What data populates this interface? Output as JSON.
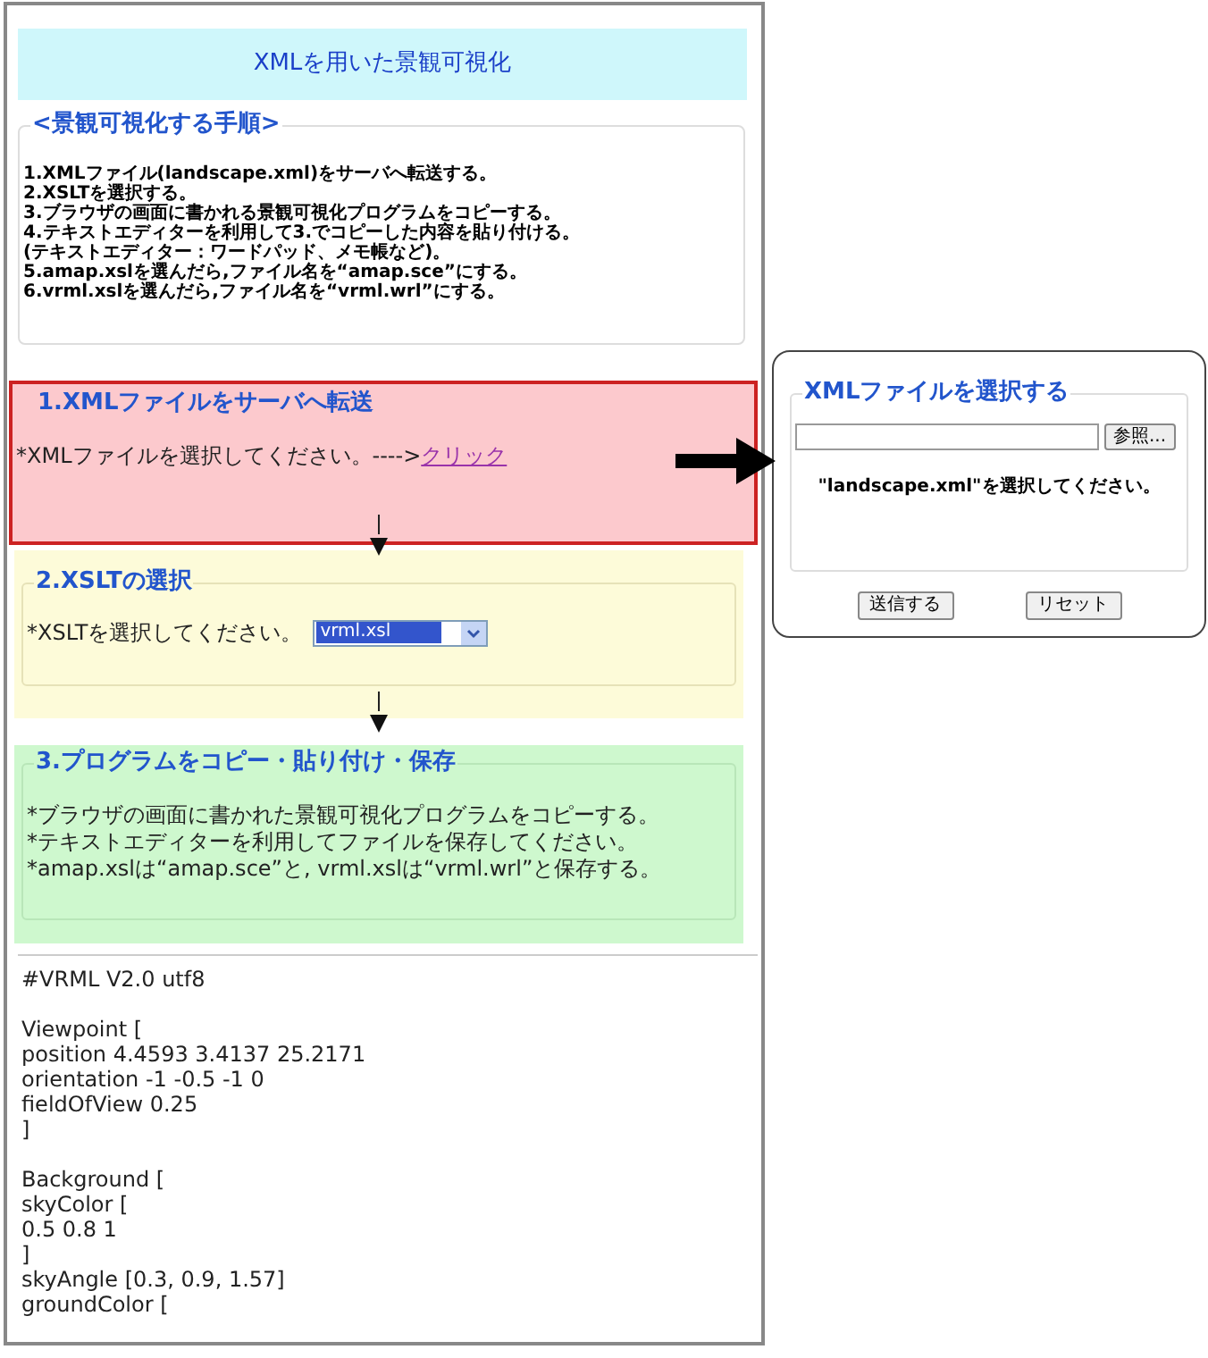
{
  "page_title": "XMLを用いた景観可視化",
  "procedure": {
    "legend": "<景観可視化する手順>",
    "steps": [
      "1.XMLファイル(landscape.xml)をサーバへ転送する。",
      "2.XSLTを選択する。",
      "3.ブラウザの画面に書かれる景観可視化プログラムをコピーする。",
      "4.テキストエディターを利用して3.でコピーした内容を貼り付ける。",
      "(テキストエディター：ワードパッド、メモ帳など)。",
      "5.amap.xslを選んだら,ファイル名を“amap.sce”にする。",
      "6.vrml.xslを選んだら,ファイル名を“vrml.wrl”にする。"
    ]
  },
  "sections": [
    {
      "kind": "upload",
      "highlighted": true,
      "title": "1.XMLファイルをサーバへ転送",
      "prompt": "*XMLファイルを選択してください。---->",
      "link": {
        "label": "クリック",
        "visited": true
      }
    },
    {
      "kind": "select",
      "highlighted": false,
      "title": "2.XSLTの選択",
      "prompt": "*XSLTを選択してください。",
      "select": {
        "value": "vrml.xsl",
        "focused": true
      }
    },
    {
      "kind": "notes",
      "highlighted": false,
      "title": "3.プログラムをコピー・貼り付け・保存",
      "lines": [
        "*ブラウザの画面に書かれた景観可視化プログラムをコピーする。",
        "*テキストエディターを利用してファイルを保存してください。",
        "*amap.xslは“amap.sce”と, vrml.xslは“vrml.wrl”と保存する。"
      ]
    }
  ],
  "vrml_output": [
    [
      "#VRML V2.0 utf8"
    ],
    [
      "Viewpoint [",
      "position 4.4593 3.4137 25.2171",
      "orientation -1 -0.5 -1 0",
      "fieldOfView 0.25",
      "]"
    ],
    [
      "Background [",
      "skyColor [",
      "0.5 0.8 1",
      "]",
      "skyAngle [0.3, 0.9, 1.57]",
      "groundColor ["
    ]
  ],
  "file_dialog": {
    "legend": "XMLファイルを選択する",
    "browse_button": "参照...",
    "hint": "\"landscape.xml\"を選択してください。",
    "buttons": [
      "送信する",
      "リセット"
    ]
  }
}
